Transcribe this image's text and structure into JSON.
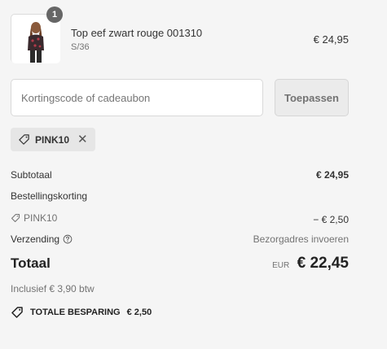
{
  "product": {
    "quantity": "1",
    "name": "Top eef zwart rouge 001310",
    "variant": "S/36",
    "price": "€ 24,95"
  },
  "discount": {
    "placeholder": "Kortingscode of cadeaubon",
    "apply_label": "Toepassen",
    "applied_code": "PINK10",
    "remove_symbol": "✕"
  },
  "summary": {
    "subtotal_label": "Subtotaal",
    "subtotal_value": "€ 24,95",
    "order_discount_label": "Bestellingskorting",
    "discount_code": "PINK10",
    "discount_value": "− € 2,50",
    "shipping_label": "Verzending",
    "shipping_value": "Bezorgadres invoeren",
    "total_label": "Totaal",
    "total_currency": "EUR",
    "total_value": "€ 22,45",
    "tax_note": "Inclusief € 3,90 btw",
    "savings_label": "TOTALE BESPARING",
    "savings_value": "€ 2,50"
  }
}
